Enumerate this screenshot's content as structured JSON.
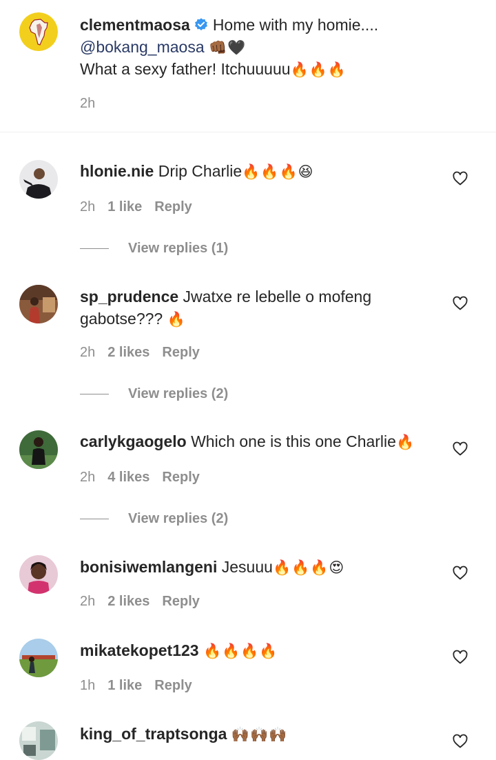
{
  "post": {
    "username": "clementmaosa",
    "verified": true,
    "caption_line1": "Home with my homie....",
    "mention": "@bokang_maosa",
    "mention_emoji": "👊🏾🖤",
    "caption_line3": "What a sexy father! Itchuuuuu",
    "caption_line3_emoji": "🔥🔥🔥",
    "time": "2h"
  },
  "comments": [
    {
      "username": "hlonie.nie",
      "text": "Drip Charlie",
      "emoji": "🔥🔥🔥😆",
      "time": "2h",
      "likes": "1 like",
      "reply_label": "Reply",
      "view_replies": "View replies (1)"
    },
    {
      "username": "sp_prudence",
      "text": "Jwatxe re lebelle o mofeng",
      "text_line2": "gabotse???",
      "emoji": "🔥",
      "time": "2h",
      "likes": "2 likes",
      "reply_label": "Reply",
      "view_replies": "View replies (2)"
    },
    {
      "username": "carlykgaogelo",
      "text": "Which one is this one Charlie",
      "emoji": "🔥",
      "time": "2h",
      "likes": "4 likes",
      "reply_label": "Reply",
      "view_replies": "View replies (2)"
    },
    {
      "username": "bonisiwemlangeni",
      "text": "Jesuuu",
      "emoji": "🔥🔥🔥😍",
      "time": "2h",
      "likes": "2 likes",
      "reply_label": "Reply"
    },
    {
      "username": "mikatekopet123",
      "text": "",
      "emoji": "🔥🔥🔥🔥",
      "time": "1h",
      "likes": "1 like",
      "reply_label": "Reply"
    },
    {
      "username": "king_of_traptsonga",
      "text": "",
      "emoji": "🙌🏾🙌🏾🙌🏾"
    }
  ],
  "colors": {
    "text": "#262626",
    "secondary": "#8e8e8e",
    "verified_blue": "#3897f0",
    "mention": "#2a3a66",
    "divider": "#efefef"
  },
  "icons": {
    "post_avatar": "africa-map-avatar",
    "verified": "verified-badge-icon",
    "like": "heart-outline-icon"
  }
}
